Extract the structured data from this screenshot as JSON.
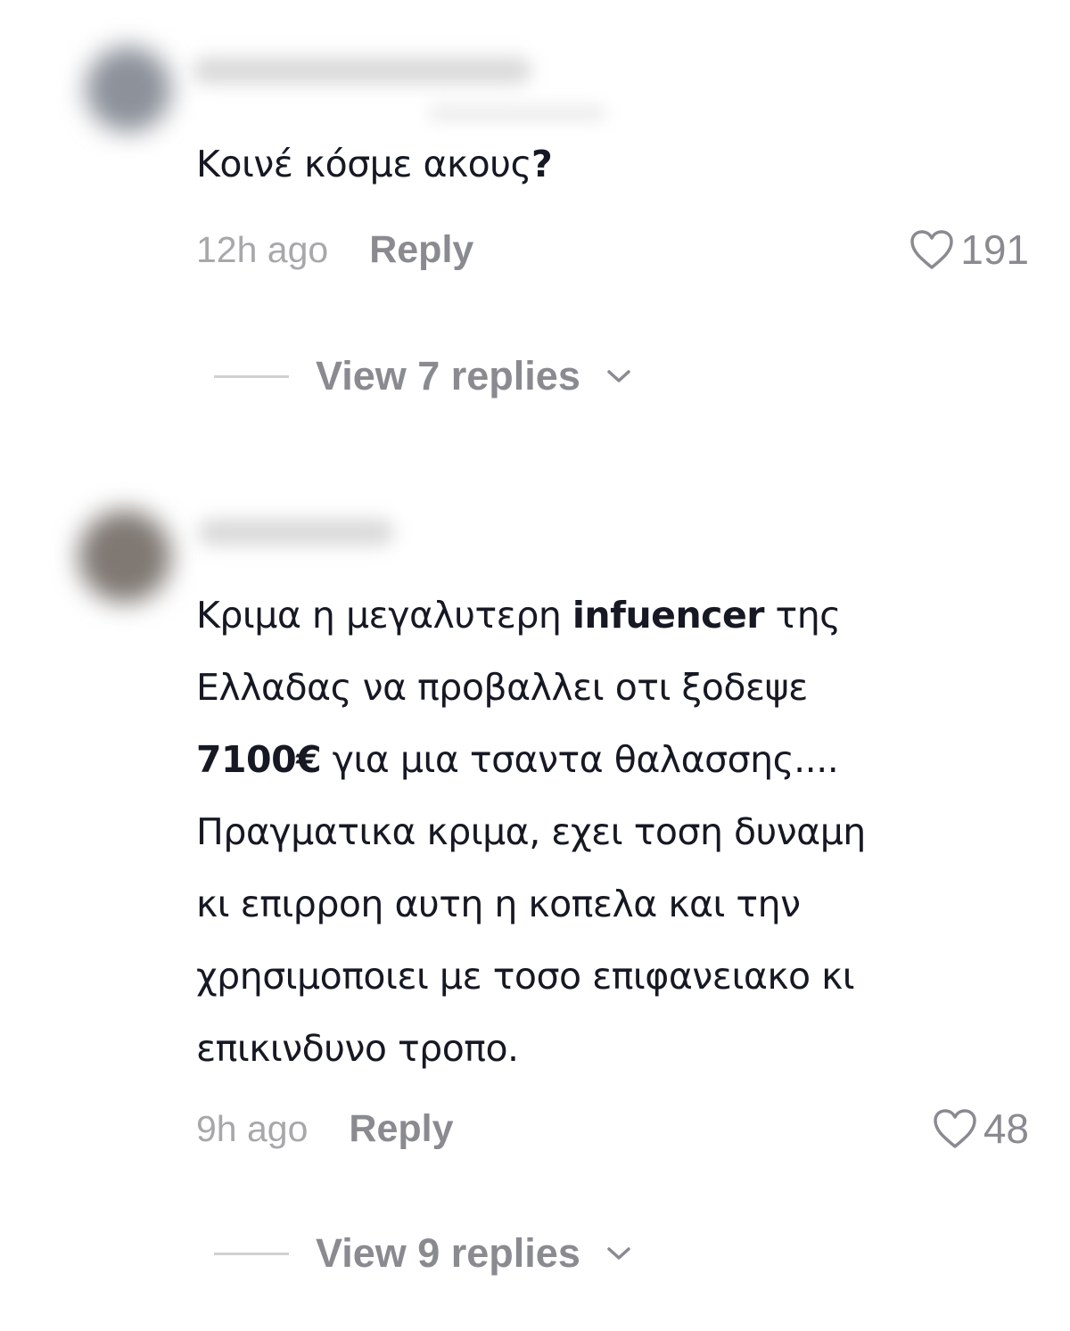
{
  "comments": [
    {
      "avatar_color": "#8a8f98",
      "text_parts": [
        {
          "text": "Κοινέ κόσμε ακους",
          "bold": false
        },
        {
          "text": "?",
          "bold": true
        }
      ],
      "time": "12h ago",
      "reply_label": "Reply",
      "likes": "191",
      "view_replies": "View 7 replies"
    },
    {
      "avatar_color": "#7d7772",
      "lines": [
        {
          "a": "Κριμα η μεγαλυτερη ",
          "b": "infuencer",
          "c": " της"
        },
        {
          "a": "Ελλαδας να προβαλλει οτι ξοδεψε",
          "b": "",
          "c": ""
        },
        {
          "a": "",
          "b": "7100€",
          "c": " για μια τσαντα θαλασσης...."
        },
        {
          "a": "Πραγματικα κριμα, εχει τοση δυναμη",
          "b": "",
          "c": ""
        },
        {
          "a": "κι επιρροη αυτη η κοπελα και την",
          "b": "",
          "c": ""
        },
        {
          "a": "χρησιμοποιει με τοσο επιφανειακο κι",
          "b": "",
          "c": ""
        },
        {
          "a": "επικινδυνο τροπο.",
          "b": "",
          "c": ""
        }
      ],
      "time": "9h ago",
      "reply_label": "Reply",
      "likes": "48",
      "view_replies": "View 9 replies"
    }
  ],
  "icons": {
    "like": "heart-outline-icon",
    "expand": "chevron-down-icon"
  }
}
